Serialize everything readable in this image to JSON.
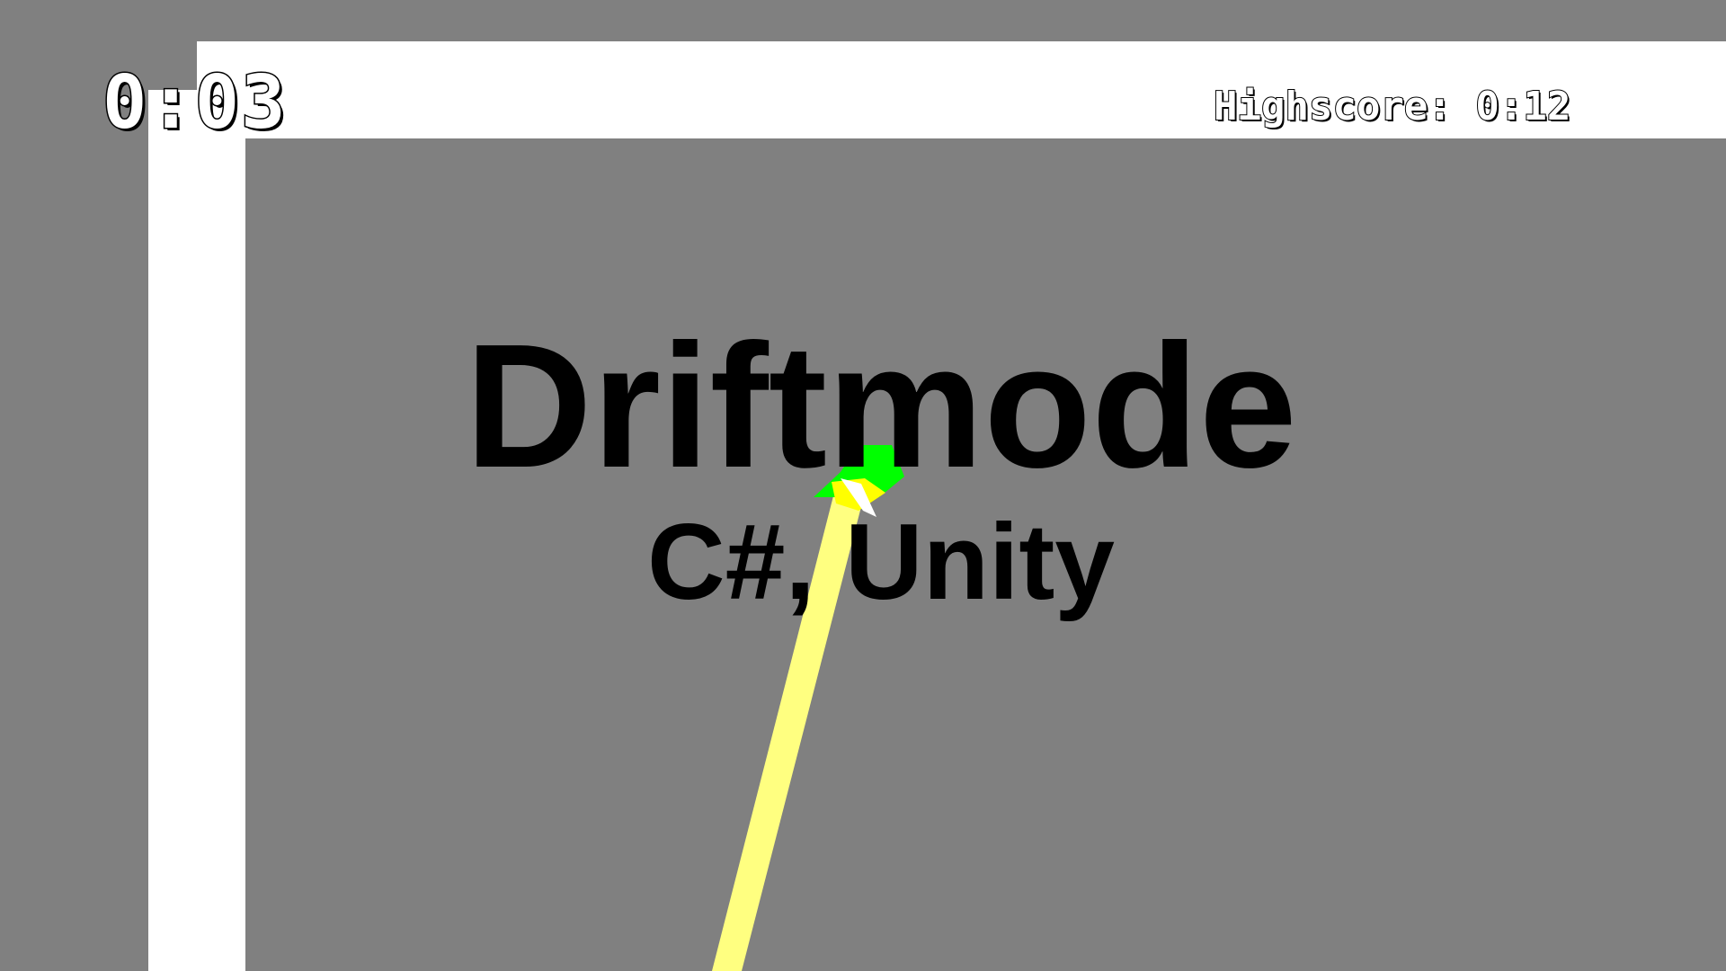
{
  "hud": {
    "timer": "0:03",
    "highscore": "Highscore: 0:12"
  },
  "overlay": {
    "title": "Driftmode",
    "subtitle": "C#, Unity"
  },
  "colors": {
    "background": "#808080",
    "walls": "#ffffff",
    "trail": "#ffff80",
    "car": "#00ff00",
    "car_front": "#ffff00",
    "text": "#000000"
  }
}
